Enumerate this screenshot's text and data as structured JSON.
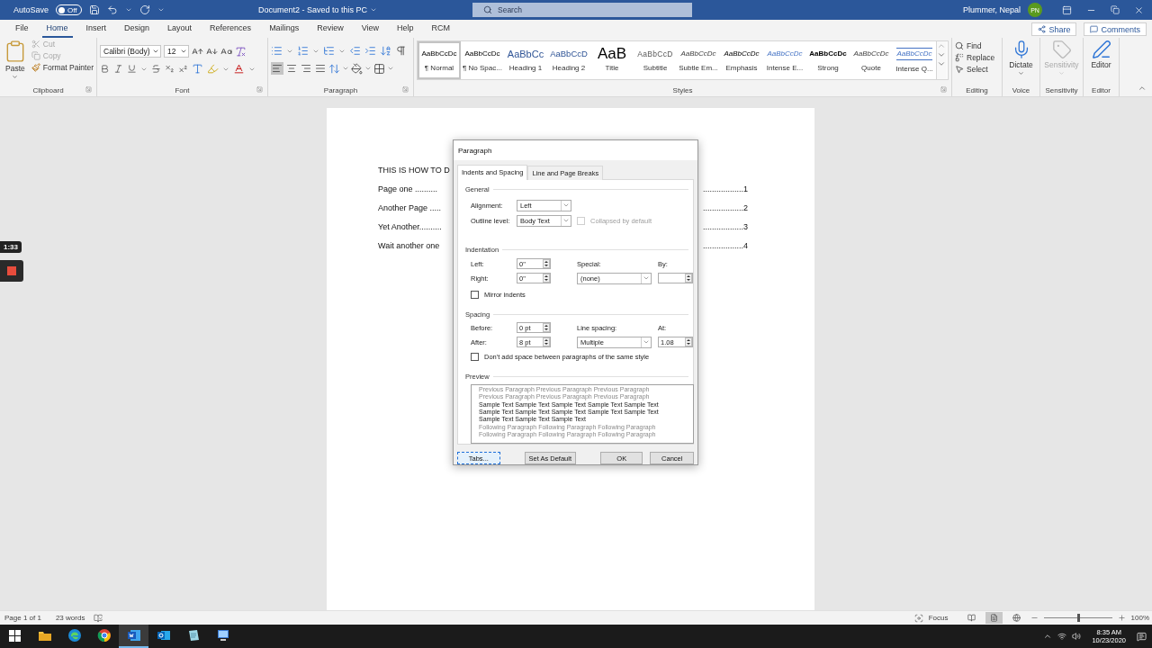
{
  "title_bar": {
    "autosave_label": "AutoSave",
    "autosave": {
      "on": false,
      "label": "Off"
    },
    "document_title": "Document2 - Saved to this PC",
    "search": {
      "placeholder": "Search"
    },
    "user_name": "Plummer, Nepal",
    "user_initials": "PN"
  },
  "ribbon_tabs": [
    {
      "label": "File",
      "selected": false
    },
    {
      "label": "Home",
      "selected": true
    },
    {
      "label": "Insert",
      "selected": false
    },
    {
      "label": "Design",
      "selected": false
    },
    {
      "label": "Layout",
      "selected": false
    },
    {
      "label": "References",
      "selected": false
    },
    {
      "label": "Mailings",
      "selected": false
    },
    {
      "label": "Review",
      "selected": false
    },
    {
      "label": "View",
      "selected": false
    },
    {
      "label": "Help",
      "selected": false
    },
    {
      "label": "RCM",
      "selected": false
    }
  ],
  "share_button": "Share",
  "comments_button": "Comments",
  "ribbon": {
    "clipboard": {
      "label": "Clipboard",
      "paste": "Paste",
      "items": [
        {
          "kind": "cut",
          "label": "Cut",
          "disabled": true
        },
        {
          "kind": "copy",
          "label": "Copy",
          "disabled": true
        },
        {
          "kind": "painter",
          "label": "Format Painter",
          "disabled": false
        }
      ]
    },
    "font": {
      "label": "Font",
      "font_name": "Calibri (Body)",
      "font_size": "12"
    },
    "paragraph": {
      "label": "Paragraph",
      "alignments": [
        {
          "kind": "left",
          "selected": true
        },
        {
          "kind": "center",
          "selected": false
        },
        {
          "kind": "right",
          "selected": false
        },
        {
          "kind": "justify",
          "selected": false
        }
      ]
    },
    "styles": {
      "label": "Styles",
      "items": [
        {
          "kind": "normal",
          "preview": "AaBbCcDc",
          "name": "¶ Normal",
          "selected": true
        },
        {
          "kind": "no-spacing",
          "preview": "AaBbCcDc",
          "name": "¶ No Spac...",
          "selected": false
        },
        {
          "kind": "heading1",
          "preview": "AaBbCc",
          "name": "Heading 1",
          "selected": false
        },
        {
          "kind": "heading2",
          "preview": "AaBbCcD",
          "name": "Heading 2",
          "selected": false
        },
        {
          "kind": "title",
          "preview": "AaB",
          "name": "Title",
          "selected": false
        },
        {
          "kind": "subtitle",
          "preview": "AaBbCcD",
          "name": "Subtitle",
          "selected": false
        },
        {
          "kind": "subtle-emphasis",
          "preview": "AaBbCcDc",
          "name": "Subtle Em...",
          "selected": false
        },
        {
          "kind": "emphasis",
          "preview": "AaBbCcDc",
          "name": "Emphasis",
          "selected": false
        },
        {
          "kind": "intense-emphasis",
          "preview": "AaBbCcDc",
          "name": "Intense E...",
          "selected": false
        },
        {
          "kind": "strong",
          "preview": "AaBbCcDc",
          "name": "Strong",
          "selected": false
        },
        {
          "kind": "quote",
          "preview": "AaBbCcDc",
          "name": "Quote",
          "selected": false
        },
        {
          "kind": "intense-quote",
          "preview": "AaBbCcDc",
          "name": "Intense Q...",
          "selected": false
        }
      ]
    },
    "editing": {
      "label": "Editing",
      "items": [
        {
          "kind": "find",
          "label": "Find"
        },
        {
          "kind": "replace",
          "label": "Replace"
        },
        {
          "kind": "select",
          "label": "Select"
        }
      ]
    },
    "voice": {
      "label": "Voice",
      "button": "Dictate"
    },
    "sensitivity": {
      "label": "Sensitivity",
      "button": "Sensitivity",
      "disabled": true
    },
    "editor": {
      "label": "Editor",
      "button": "Editor"
    }
  },
  "document": {
    "heading": "THIS IS HOW TO D",
    "toc": [
      {
        "left": "Page one ..........",
        "right": "..................1"
      },
      {
        "left": "Another Page .....",
        "right": "..................2"
      },
      {
        "left": "Yet Another..........",
        "right": "..................3"
      },
      {
        "left": "Wait another one",
        "right": "..................4"
      }
    ]
  },
  "recording": {
    "timer": "1:33"
  },
  "dialog": {
    "title": "Paragraph",
    "tabs": [
      {
        "label": "Indents and Spacing",
        "selected": true
      },
      {
        "label": "Line and Page Breaks",
        "selected": false
      }
    ],
    "general": {
      "heading": "General",
      "alignment": {
        "label": "Alignment:",
        "value": "Left"
      },
      "outline_level": {
        "label": "Outline level:",
        "value": "Body Text"
      },
      "collapsed": {
        "label": "Collapsed by default",
        "checked": false,
        "disabled": true
      }
    },
    "indentation": {
      "heading": "Indentation",
      "left": {
        "label": "Left:",
        "value": "0\""
      },
      "right": {
        "label": "Right:",
        "value": "0\""
      },
      "special": {
        "label": "Special:",
        "value": "(none)"
      },
      "by": {
        "label": "By:"
      },
      "mirror": {
        "label": "Mirror indents",
        "checked": false
      }
    },
    "spacing": {
      "heading": "Spacing",
      "before": {
        "label": "Before:",
        "value": "0 pt"
      },
      "after": {
        "label": "After:",
        "value": "8 pt"
      },
      "line_spacing": {
        "label": "Line spacing:",
        "value": "Multiple"
      },
      "at": {
        "label": "At:",
        "value": "1.08"
      },
      "dont_add": {
        "label": "Don't add space between paragraphs of the same style",
        "checked": false
      }
    },
    "preview": {
      "heading": "Preview",
      "previous": [
        "Previous Paragraph Previous Paragraph Previous Paragraph",
        "Previous Paragraph Previous Paragraph Previous Paragraph"
      ],
      "sample": [
        "Sample Text Sample Text Sample Text Sample Text Sample Text",
        "Sample Text Sample Text Sample Text Sample Text Sample Text",
        "Sample Text Sample Text Sample Text"
      ],
      "following": [
        "Following Paragraph Following Paragraph Following Paragraph",
        "Following Paragraph Following Paragraph Following Paragraph"
      ]
    },
    "buttons": [
      {
        "kind": "tabs",
        "label": "Tabs...",
        "focused": true
      },
      {
        "kind": "default",
        "label": "Set As Default",
        "focused": false
      },
      {
        "kind": "ok",
        "label": "OK",
        "focused": false
      },
      {
        "kind": "cancel",
        "label": "Cancel",
        "focused": false
      }
    ]
  },
  "status_bar": {
    "page": "Page 1 of 1",
    "words": "23 words",
    "focus": "Focus",
    "views": [
      {
        "kind": "read",
        "selected": false
      },
      {
        "kind": "print",
        "selected": true
      },
      {
        "kind": "web",
        "selected": false
      }
    ],
    "zoom": {
      "level": 0.5,
      "reading": "100%"
    }
  },
  "taskbar": {
    "apps": [
      {
        "kind": "explorer",
        "active": false
      },
      {
        "kind": "edge",
        "active": false
      },
      {
        "kind": "chrome",
        "active": false
      },
      {
        "kind": "word",
        "active": true
      },
      {
        "kind": "outlook",
        "active": false
      },
      {
        "kind": "notepad",
        "active": false
      },
      {
        "kind": "computer",
        "active": false
      }
    ],
    "time": "8:35 AM",
    "date": "10/23/2020"
  }
}
